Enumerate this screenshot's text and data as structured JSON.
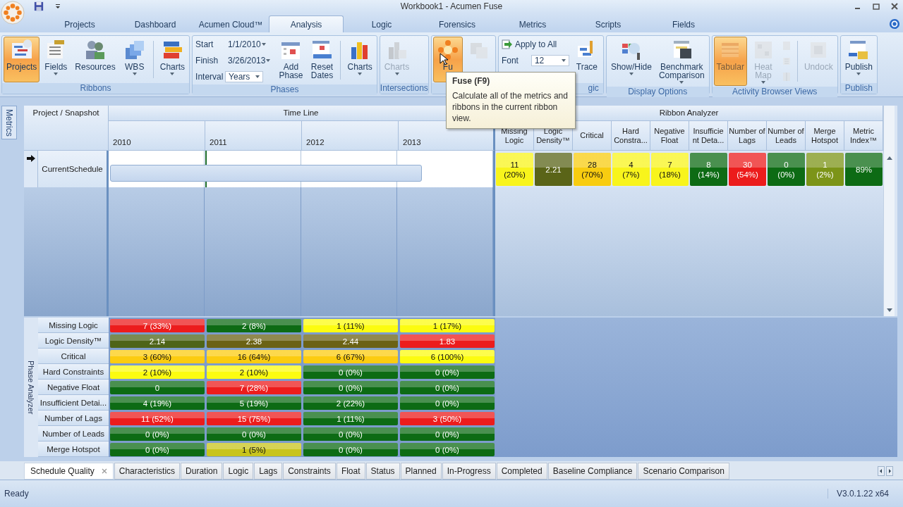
{
  "window": {
    "title": "Workbook1 - Acumen Fuse"
  },
  "menu_tabs": [
    {
      "label": "Projects",
      "selected": false
    },
    {
      "label": "Dashboard",
      "selected": false
    },
    {
      "label": "Acumen Cloud™",
      "selected": false
    },
    {
      "label": "Analysis",
      "selected": true
    },
    {
      "label": "Logic",
      "selected": false
    },
    {
      "label": "Forensics",
      "selected": false
    },
    {
      "label": "Metrics",
      "selected": false
    },
    {
      "label": "Scripts",
      "selected": false
    },
    {
      "label": "Fields",
      "selected": false
    }
  ],
  "ribbon": [
    {
      "label": "Ribbons",
      "items": [
        {
          "kind": "large",
          "label": "Projects",
          "selected": true,
          "disabled": false,
          "dropdown": false
        },
        {
          "kind": "large",
          "label": "Fields",
          "selected": false,
          "disabled": false,
          "dropdown": true
        },
        {
          "kind": "large",
          "label": "Resources",
          "selected": false,
          "disabled": false,
          "dropdown": false
        },
        {
          "kind": "large",
          "label": "WBS",
          "selected": false,
          "disabled": false,
          "dropdown": true
        },
        {
          "kind": "separator"
        },
        {
          "kind": "large",
          "label": "Charts",
          "selected": false,
          "disabled": false,
          "dropdown": true
        }
      ]
    },
    {
      "label": "Phases",
      "items": [
        {
          "kind": "form",
          "rows": [
            {
              "kind": "date",
              "label": "Start",
              "value": "1/1/2010"
            },
            {
              "kind": "date",
              "label": "Finish",
              "value": "3/26/2013"
            },
            {
              "kind": "select",
              "label": "Interval",
              "value": "Years"
            }
          ]
        },
        {
          "kind": "large",
          "label": "Add Phase",
          "selected": false,
          "disabled": false,
          "dropdown": false
        },
        {
          "kind": "large",
          "label": "Reset Dates",
          "selected": false,
          "disabled": false,
          "dropdown": false
        },
        {
          "kind": "separator"
        },
        {
          "kind": "large",
          "label": "Charts",
          "selected": false,
          "disabled": false,
          "dropdown": true
        }
      ]
    },
    {
      "label": "Intersections",
      "items": [
        {
          "kind": "large",
          "label": "Charts",
          "selected": false,
          "disabled": true,
          "dropdown": true
        }
      ]
    },
    {
      "items": [
        {
          "kind": "large",
          "label": "Fu",
          "selected": true,
          "disabled": false,
          "dropdown": false,
          "tooltip": {
            "title": "Fuse (F9)",
            "text": "Calculate all of the metrics and ribbons in the current ribbon view."
          }
        },
        {
          "kind": "large",
          "selected": false,
          "disabled": true,
          "dropdown": false
        }
      ]
    },
    {
      "label": "gic",
      "items": [
        {
          "kind": "form",
          "rows": [
            {
              "kind": "action",
              "label": "Apply to All"
            },
            {
              "kind": "select",
              "label": "Font",
              "value": "12"
            }
          ]
        },
        {
          "kind": "large",
          "label": "Trace",
          "selected": false,
          "disabled": false,
          "dropdown": false
        }
      ]
    },
    {
      "label": "Display Options",
      "items": [
        {
          "kind": "large",
          "label": "Show/Hide",
          "selected": false,
          "disabled": false,
          "dropdown": true
        },
        {
          "kind": "large",
          "label": "Benchmark Comparison",
          "selected": false,
          "disabled": false,
          "dropdown": true
        }
      ]
    },
    {
      "label": "Activity Browser Views",
      "items": [
        {
          "kind": "large",
          "label": "Tabular",
          "selected": true,
          "disabled": true,
          "dropdown": false
        },
        {
          "kind": "large",
          "label": "Heat Map",
          "selected": false,
          "disabled": true,
          "dropdown": true
        },
        {
          "kind": "icons",
          "disabled": true
        },
        {
          "kind": "separator"
        },
        {
          "kind": "large",
          "label": "Undock",
          "selected": false,
          "disabled": true,
          "dropdown": false
        }
      ]
    },
    {
      "label": "Publish",
      "items": [
        {
          "kind": "large",
          "label": "Publish",
          "selected": false,
          "disabled": false,
          "dropdown": true
        }
      ]
    }
  ],
  "side_tab": "Metrics",
  "project_header": "Project / Snapshot",
  "timeline": {
    "title": "Time Line",
    "years": [
      "2010",
      "2011",
      "2012",
      "2013"
    ]
  },
  "projects": [
    {
      "name": "CurrentSchedule",
      "selected": true
    }
  ],
  "ribbon_analyzer": {
    "title": "Ribbon Analyzer",
    "columns": [
      "Missing Logic",
      "Logic Density™",
      "Critical",
      "Hard Constra...",
      "Negative Float",
      "Insufficie nt Deta...",
      "Number of Lags",
      "Number of Leads",
      "Merge Hotspot",
      "Metric Index™"
    ],
    "cells": [
      {
        "value": "11",
        "percent": "(20%)",
        "color": "#f8f41c"
      },
      {
        "value": "2.21",
        "color": "#5a6418"
      },
      {
        "value": "28",
        "percent": "(70%)",
        "color": "#f8cc10"
      },
      {
        "value": "4",
        "percent": "(7%)",
        "color": "#f8f41c"
      },
      {
        "value": "7",
        "percent": "(18%)",
        "color": "#f8f41c"
      },
      {
        "value": "8",
        "percent": "(14%)",
        "color": "#0d6b14"
      },
      {
        "value": "30",
        "percent": "(54%)",
        "color": "#ec1c1c"
      },
      {
        "value": "0",
        "percent": "(0%)",
        "color": "#0d6b14"
      },
      {
        "value": "1",
        "percent": "(2%)",
        "color": "#7c9418"
      },
      {
        "value": "89%",
        "color": "#0d6b14"
      }
    ]
  },
  "phase_analyzer": {
    "title": "Phase Analyzer",
    "rows": [
      {
        "label": "Missing Logic",
        "cells": [
          {
            "text": "7 (33%)",
            "color": "#ec1c1c"
          },
          {
            "text": "2 (8%)",
            "color": "#0d6b14"
          },
          {
            "text": "1 (11%)",
            "color": "#fcfc10"
          },
          {
            "text": "1 (17%)",
            "color": "#fcfc10"
          }
        ]
      },
      {
        "label": "Logic Density™",
        "cells": [
          {
            "text": "2.14",
            "color": "#4e6418"
          },
          {
            "text": "2.38",
            "color": "#6b6214"
          },
          {
            "text": "2.44",
            "color": "#6b6214"
          },
          {
            "text": "1.83",
            "color": "#ec1c1c"
          }
        ]
      },
      {
        "label": "Critical",
        "cells": [
          {
            "text": "3 (60%)",
            "color": "#fccc10"
          },
          {
            "text": "16 (64%)",
            "color": "#fccc10"
          },
          {
            "text": "6 (67%)",
            "color": "#fccc10"
          },
          {
            "text": "6 (100%)",
            "color": "#fcfc10"
          }
        ]
      },
      {
        "label": "Hard Constraints",
        "cells": [
          {
            "text": "2 (10%)",
            "color": "#fcfc10"
          },
          {
            "text": "2 (10%)",
            "color": "#fcfc10"
          },
          {
            "text": "0 (0%)",
            "color": "#0d6b14"
          },
          {
            "text": "0 (0%)",
            "color": "#0d6b14"
          }
        ]
      },
      {
        "label": "Negative Float",
        "cells": [
          {
            "text": "0",
            "color": "#0d6b14"
          },
          {
            "text": "7 (28%)",
            "color": "#ec1c1c"
          },
          {
            "text": "0 (0%)",
            "color": "#0d6b14"
          },
          {
            "text": "0 (0%)",
            "color": "#0d6b14"
          }
        ]
      },
      {
        "label": "Insufficient Detai...",
        "cells": [
          {
            "text": "4 (19%)",
            "color": "#0d6b14"
          },
          {
            "text": "5 (19%)",
            "color": "#0d6b14"
          },
          {
            "text": "2 (22%)",
            "color": "#0d6b14"
          },
          {
            "text": "0 (0%)",
            "color": "#0d6b14"
          }
        ]
      },
      {
        "label": "Number of Lags",
        "cells": [
          {
            "text": "11 (52%)",
            "color": "#ec1c1c"
          },
          {
            "text": "15 (75%)",
            "color": "#ec1c1c"
          },
          {
            "text": "1 (11%)",
            "color": "#0d6b14"
          },
          {
            "text": "3 (50%)",
            "color": "#ec1c1c"
          }
        ]
      },
      {
        "label": "Number of Leads",
        "cells": [
          {
            "text": "0 (0%)",
            "color": "#0d6b14"
          },
          {
            "text": "0 (0%)",
            "color": "#0d6b14"
          },
          {
            "text": "0 (0%)",
            "color": "#0d6b14"
          },
          {
            "text": "0 (0%)",
            "color": "#0d6b14"
          }
        ]
      },
      {
        "label": "Merge Hotspot",
        "cells": [
          {
            "text": "0 (0%)",
            "color": "#0d6b14"
          },
          {
            "text": "1 (5%)",
            "color": "#c8c41c"
          },
          {
            "text": "0 (0%)",
            "color": "#0d6b14"
          },
          {
            "text": "0 (0%)",
            "color": "#0d6b14"
          }
        ]
      }
    ]
  },
  "sheet_tabs": [
    {
      "label": "Schedule Quality",
      "selected": true,
      "closable": true
    },
    {
      "label": "Characteristics",
      "selected": false,
      "closable": false
    },
    {
      "label": "Duration",
      "selected": false,
      "closable": false
    },
    {
      "label": "Logic",
      "selected": false,
      "closable": false
    },
    {
      "label": "Lags",
      "selected": false,
      "closable": false
    },
    {
      "label": "Constraints",
      "selected": false,
      "closable": false
    },
    {
      "label": "Float",
      "selected": false,
      "closable": false
    },
    {
      "label": "Status",
      "selected": false,
      "closable": false
    },
    {
      "label": "Planned",
      "selected": false,
      "closable": false
    },
    {
      "label": "In-Progress",
      "selected": false,
      "closable": false
    },
    {
      "label": "Completed",
      "selected": false,
      "closable": false
    },
    {
      "label": "Baseline Compliance",
      "selected": false,
      "closable": false
    },
    {
      "label": "Scenario Comparison",
      "selected": false,
      "closable": false
    }
  ],
  "status_bar": {
    "text": "Ready",
    "version": "V3.0.1.22 x64"
  }
}
